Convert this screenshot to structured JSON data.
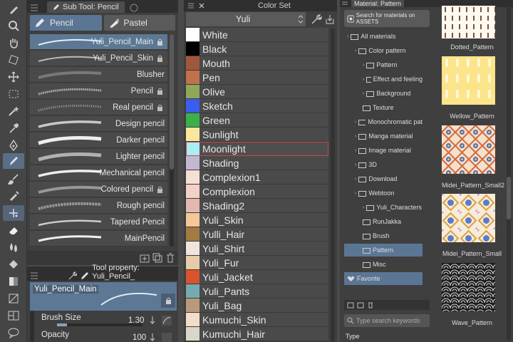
{
  "subtool": {
    "tab_title": "Sub Tool: Pencil",
    "groups": [
      "Pencil",
      "Pastel"
    ],
    "brushes": [
      "Yuli_Pencil_Main",
      "Yuli_Pencil_Skin",
      "Blusher",
      "Pencil",
      "Real pencil",
      "Design pencil",
      "Darker pencil",
      "Lighter pencil",
      "Mechanical pencil",
      "Colored pencil",
      "Rough pencil",
      "Tapered Pencil",
      "MainPencil"
    ]
  },
  "toolprop": {
    "title": "Tool property: Yuli_Pencil_",
    "preview_name": "Yuli_Pencil_Main",
    "brush_size_label": "Brush Size",
    "brush_size_value": "1.30",
    "opacity_label": "Opacity",
    "opacity_value": "100"
  },
  "colorset": {
    "title": "Color Set",
    "set_name": "Yuli",
    "colors": [
      {
        "name": "White",
        "hex": "#ffffff"
      },
      {
        "name": "Black",
        "hex": "#000000"
      },
      {
        "name": "Mouth",
        "hex": "#a0573a"
      },
      {
        "name": "Pen",
        "hex": "#c0714e"
      },
      {
        "name": "Olive",
        "hex": "#8fa858"
      },
      {
        "name": "Sketch",
        "hex": "#3a5cf0"
      },
      {
        "name": "Green",
        "hex": "#3cb048"
      },
      {
        "name": "Sunlight",
        "hex": "#fbe6a0"
      },
      {
        "name": "Moonlight",
        "hex": "#a8eef5"
      },
      {
        "name": "Shading",
        "hex": "#c2b8d2"
      },
      {
        "name": "Complexion1",
        "hex": "#f6dfd5"
      },
      {
        "name": "Complexion",
        "hex": "#f2d2c4"
      },
      {
        "name": "Shading2",
        "hex": "#e2b8b0"
      },
      {
        "name": "Yuli_Skin",
        "hex": "#f4c89a"
      },
      {
        "name": "Yulli_Hair",
        "hex": "#a37a40"
      },
      {
        "name": "Yuli_Shirt",
        "hex": "#efe4de"
      },
      {
        "name": "Yuli_Fur",
        "hex": "#e8cca8"
      },
      {
        "name": "Yuli_Jacket",
        "hex": "#d8542c"
      },
      {
        "name": "Yuli_Pants",
        "hex": "#74aab0"
      },
      {
        "name": "Yuli_Bag",
        "hex": "#b89a7a"
      },
      {
        "name": "Kumuchi_Skin",
        "hex": "#f3dcc8"
      },
      {
        "name": "Kumuchi_Hair",
        "hex": "#d8d8c8"
      }
    ]
  },
  "material": {
    "tab_title": "Material: Pattern",
    "search_button": "Search for materials on ASSETS",
    "tree": [
      "All materials",
      "Color pattern",
      "Pattern",
      "Effect and feeling",
      "Background",
      "Texture",
      "Monochromatic pat",
      "Manga material",
      "Image material",
      "3D",
      "Download",
      "Webtoon",
      "Yuli_Characters",
      "RunJakka",
      "Brush",
      "Pattern",
      "Misc",
      "Favorite"
    ],
    "search_placeholder": "Type search keywords",
    "type_label": "Type",
    "thumbs": [
      "Dotted_Pattern",
      "Wellow_Pattern",
      "Midei_Pattern_Small2",
      "Midei_Pattern_Small",
      "Wave_Pattern"
    ]
  }
}
